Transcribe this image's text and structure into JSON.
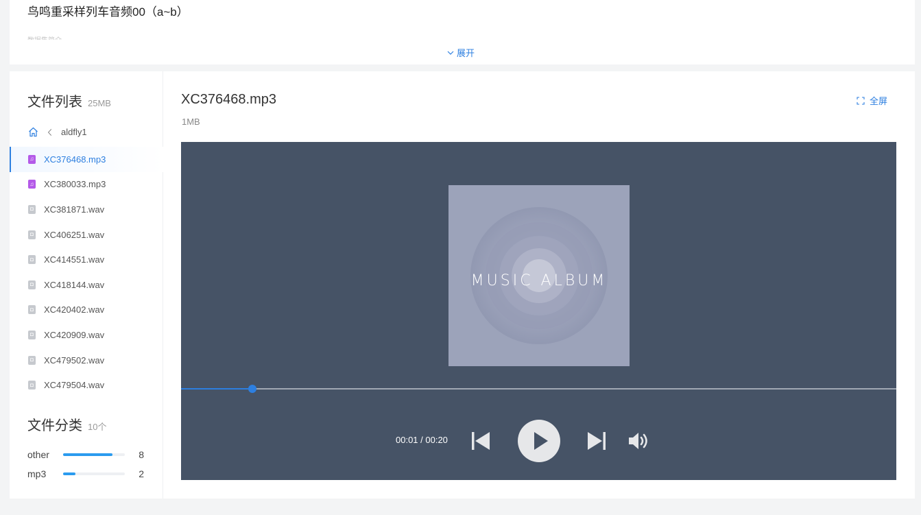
{
  "header": {
    "title": "鸟鸣重采样列车音频00（a~b）",
    "faded_text": "数据集简介",
    "expand_label": "展开"
  },
  "file_list": {
    "title": "文件列表",
    "total_size": "25MB",
    "breadcrumb": "aldfly1",
    "files": [
      {
        "name": "XC376468.mp3",
        "type": "mp3",
        "active": true
      },
      {
        "name": "XC380033.mp3",
        "type": "mp3",
        "active": false
      },
      {
        "name": "XC381871.wav",
        "type": "other",
        "active": false
      },
      {
        "name": "XC406251.wav",
        "type": "other",
        "active": false
      },
      {
        "name": "XC414551.wav",
        "type": "other",
        "active": false
      },
      {
        "name": "XC418144.wav",
        "type": "other",
        "active": false
      },
      {
        "name": "XC420402.wav",
        "type": "other",
        "active": false
      },
      {
        "name": "XC420909.wav",
        "type": "other",
        "active": false
      },
      {
        "name": "XC479502.wav",
        "type": "other",
        "active": false
      },
      {
        "name": "XC479504.wav",
        "type": "other",
        "active": false
      }
    ]
  },
  "categories": {
    "title": "文件分类",
    "total": "10个",
    "items": [
      {
        "name": "other",
        "count": "8",
        "fraction": 0.8
      },
      {
        "name": "mp3",
        "count": "2",
        "fraction": 0.2
      }
    ]
  },
  "viewer": {
    "file_name": "XC376468.mp3",
    "file_size": "1MB",
    "fullscreen_label": "全屏"
  },
  "player": {
    "cover_text": "MUSIC ALBUM",
    "time": "00:01 / 00:20",
    "progress": 0.1,
    "colors": {
      "background": "#465366",
      "accent": "#2d7fe0",
      "cover": "#9ca3ba"
    }
  },
  "icons": {
    "breadcrumb_home": "home-icon",
    "breadcrumb_back": "chevron-left-icon",
    "expand": "chevron-down-icon",
    "fullscreen": "fullscreen-icon",
    "prev": "skip-back-icon",
    "play": "play-icon",
    "next": "skip-forward-icon",
    "volume": "volume-icon"
  }
}
